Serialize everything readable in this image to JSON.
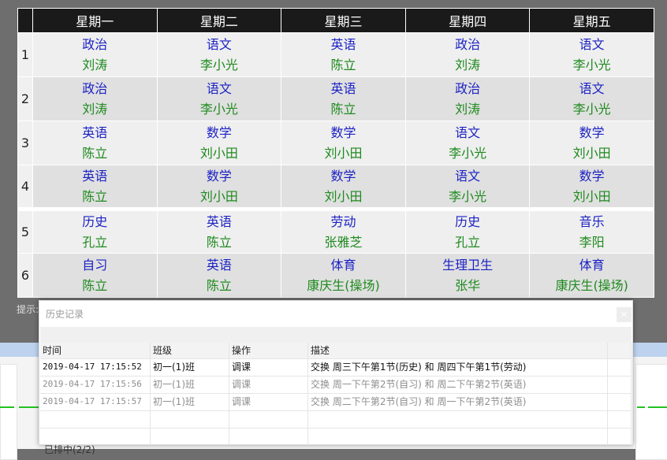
{
  "schedule": {
    "days": [
      "星期一",
      "星期二",
      "星期三",
      "星期四",
      "星期五"
    ],
    "rows": [
      {
        "no": "1",
        "cells": [
          {
            "subject": "政治",
            "teacher": "刘涛"
          },
          {
            "subject": "语文",
            "teacher": "李小光"
          },
          {
            "subject": "英语",
            "teacher": "陈立"
          },
          {
            "subject": "政治",
            "teacher": "刘涛"
          },
          {
            "subject": "语文",
            "teacher": "李小光"
          }
        ]
      },
      {
        "no": "2",
        "cells": [
          {
            "subject": "政治",
            "teacher": "刘涛"
          },
          {
            "subject": "语文",
            "teacher": "李小光"
          },
          {
            "subject": "英语",
            "teacher": "陈立"
          },
          {
            "subject": "政治",
            "teacher": "刘涛"
          },
          {
            "subject": "语文",
            "teacher": "李小光"
          }
        ]
      },
      {
        "no": "3",
        "cells": [
          {
            "subject": "英语",
            "teacher": "陈立"
          },
          {
            "subject": "数学",
            "teacher": "刘小田"
          },
          {
            "subject": "数学",
            "teacher": "刘小田"
          },
          {
            "subject": "语文",
            "teacher": "李小光"
          },
          {
            "subject": "数学",
            "teacher": "刘小田"
          }
        ]
      },
      {
        "no": "4",
        "cells": [
          {
            "subject": "英语",
            "teacher": "陈立"
          },
          {
            "subject": "数学",
            "teacher": "刘小田"
          },
          {
            "subject": "数学",
            "teacher": "刘小田"
          },
          {
            "subject": "语文",
            "teacher": "李小光"
          },
          {
            "subject": "数学",
            "teacher": "刘小田"
          }
        ]
      },
      {
        "no": "5",
        "cells": [
          {
            "subject": "历史",
            "teacher": "孔立"
          },
          {
            "subject": "英语",
            "teacher": "陈立"
          },
          {
            "subject": "劳动",
            "teacher": "张雅芝"
          },
          {
            "subject": "历史",
            "teacher": "孔立"
          },
          {
            "subject": "音乐",
            "teacher": "李阳"
          }
        ]
      },
      {
        "no": "6",
        "cells": [
          {
            "subject": "自习",
            "teacher": "陈立"
          },
          {
            "subject": "英语",
            "teacher": "陈立"
          },
          {
            "subject": "体育",
            "teacher": "康庆生(操场)"
          },
          {
            "subject": "生理卫生",
            "teacher": "张华"
          },
          {
            "subject": "体育",
            "teacher": "康庆生(操场)"
          }
        ]
      }
    ]
  },
  "hint": {
    "label": "提示:"
  },
  "background": {
    "status_text": "已排中(2/2)"
  },
  "history_dialog": {
    "title": "历史记录",
    "close_icon": "close-icon",
    "columns": [
      "时间",
      "班级",
      "操作",
      "描述"
    ],
    "records": [
      {
        "time": "2019-04-17 17:15:52",
        "class": "初一(1)班",
        "action": "调课",
        "description": "交换 周三下午第1节(历史) 和 周四下午第1节(劳动)",
        "active": true
      },
      {
        "time": "2019-04-17 17:15:56",
        "class": "初一(1)班",
        "action": "调课",
        "description": "交换 周一下午第2节(自习) 和 周二下午第2节(英语)",
        "active": false
      },
      {
        "time": "2019-04-17 17:15:57",
        "class": "初一(1)班",
        "action": "调课",
        "description": "交换 周二下午第2节(自习) 和 周一下午第2节(英语)",
        "active": false
      }
    ]
  },
  "colors": {
    "subject": "#1c22c4",
    "teacher": "#1e8a1e",
    "header_bg": "#1a1a1a",
    "overlay": "#6e6e6e"
  }
}
